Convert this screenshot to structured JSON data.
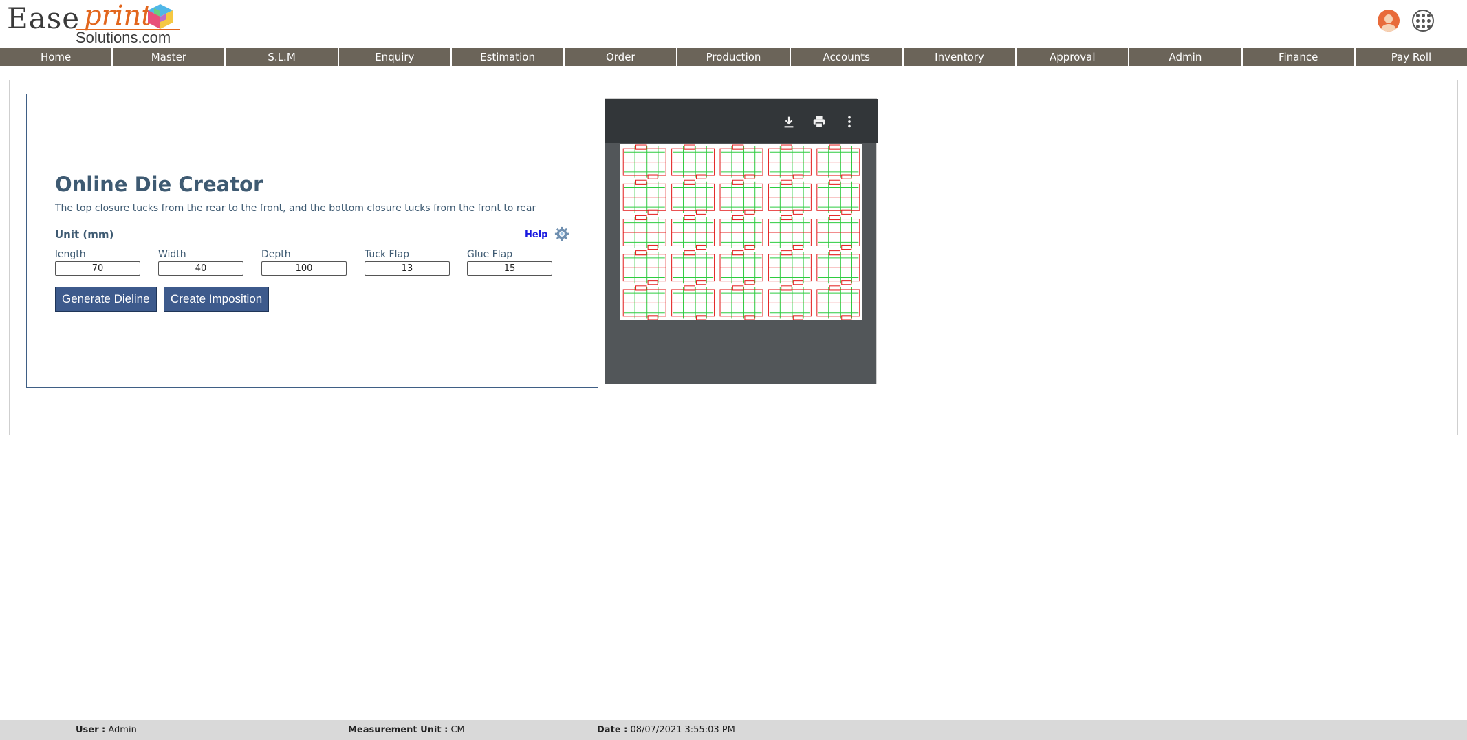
{
  "brand": {
    "logo_word1": "Ease",
    "logo_word2": "print",
    "logo_word3": "Solutions.com",
    "accent_color": "#e2661d"
  },
  "header": {
    "user_icon": "user-avatar-icon",
    "apps_icon": "apps-grid-icon"
  },
  "nav": {
    "items": [
      "Home",
      "Master",
      "S.L.M",
      "Enquiry",
      "Estimation",
      "Order",
      "Production",
      "Accounts",
      "Inventory",
      "Approval",
      "Admin",
      "Finance",
      "Pay Roll"
    ],
    "background": "#6b6459"
  },
  "die_creator": {
    "title": "Online Die Creator",
    "description": "The top closure tucks from the rear to the front, and the bottom closure tucks from the front to rear",
    "unit_label": "Unit (mm)",
    "help_label": "Help",
    "fields": [
      {
        "label": "length",
        "value": "70"
      },
      {
        "label": "Width",
        "value": "40"
      },
      {
        "label": "Depth",
        "value": "100"
      },
      {
        "label": "Tuck Flap",
        "value": "13"
      },
      {
        "label": "Glue Flap",
        "value": "15"
      }
    ],
    "buttons": {
      "generate": "Generate Dieline",
      "imposition": "Create Imposition"
    },
    "button_color": "#3d5a8c"
  },
  "viewer": {
    "toolbar_icons": [
      "download-icon",
      "print-icon",
      "more-vert-icon"
    ],
    "imposition": {
      "columns": 5,
      "rows": 5,
      "cut_color": "#e31b1b",
      "crease_color": "#2ecc40"
    }
  },
  "footer": {
    "user_label": "User :",
    "user_value": "Admin",
    "unit_label": "Measurement Unit :",
    "unit_value": "CM",
    "date_label": "Date :",
    "date_value": "08/07/2021 3:55:03 PM"
  }
}
